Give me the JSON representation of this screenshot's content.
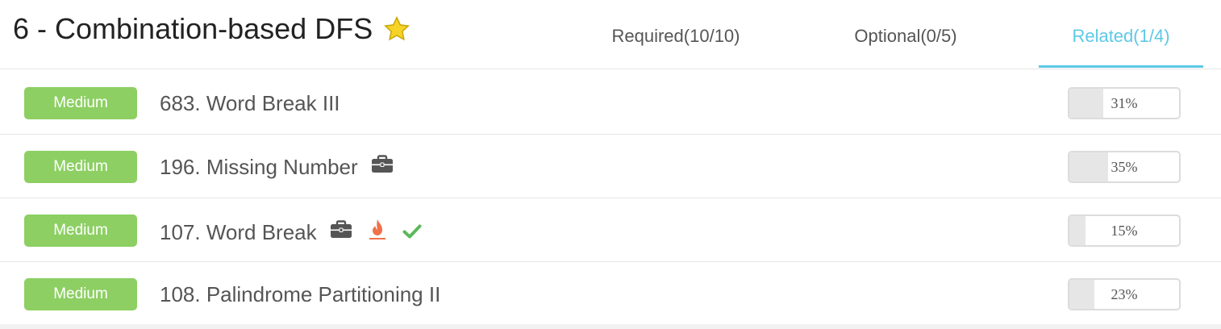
{
  "header": {
    "title": "6 - Combination-based DFS",
    "star_icon": "star-icon",
    "star_color": "#f5d327"
  },
  "tabs": [
    {
      "label": "Required(10/10)",
      "active": false
    },
    {
      "label": "Optional(0/5)",
      "active": false
    },
    {
      "label": "Related(1/4)",
      "active": true
    }
  ],
  "colors": {
    "accent": "#5ec8e6",
    "medium_badge": "#8dcf63",
    "hot_icon": "#f0704a",
    "check_icon": "#5cb85c",
    "briefcase_icon": "#555555"
  },
  "problems": [
    {
      "difficulty": "Medium",
      "title": "683. Word Break III",
      "icons": [],
      "progress_label": "31%",
      "progress": 0.31
    },
    {
      "difficulty": "Medium",
      "title": "196. Missing Number",
      "icons": [
        "briefcase-icon"
      ],
      "progress_label": "35%",
      "progress": 0.35
    },
    {
      "difficulty": "Medium",
      "title": "107. Word Break",
      "icons": [
        "briefcase-icon",
        "hot-icon",
        "check-icon"
      ],
      "progress_label": "15%",
      "progress": 0.15
    },
    {
      "difficulty": "Medium",
      "title": "108. Palindrome Partitioning II",
      "icons": [],
      "progress_label": "23%",
      "progress": 0.23
    }
  ]
}
